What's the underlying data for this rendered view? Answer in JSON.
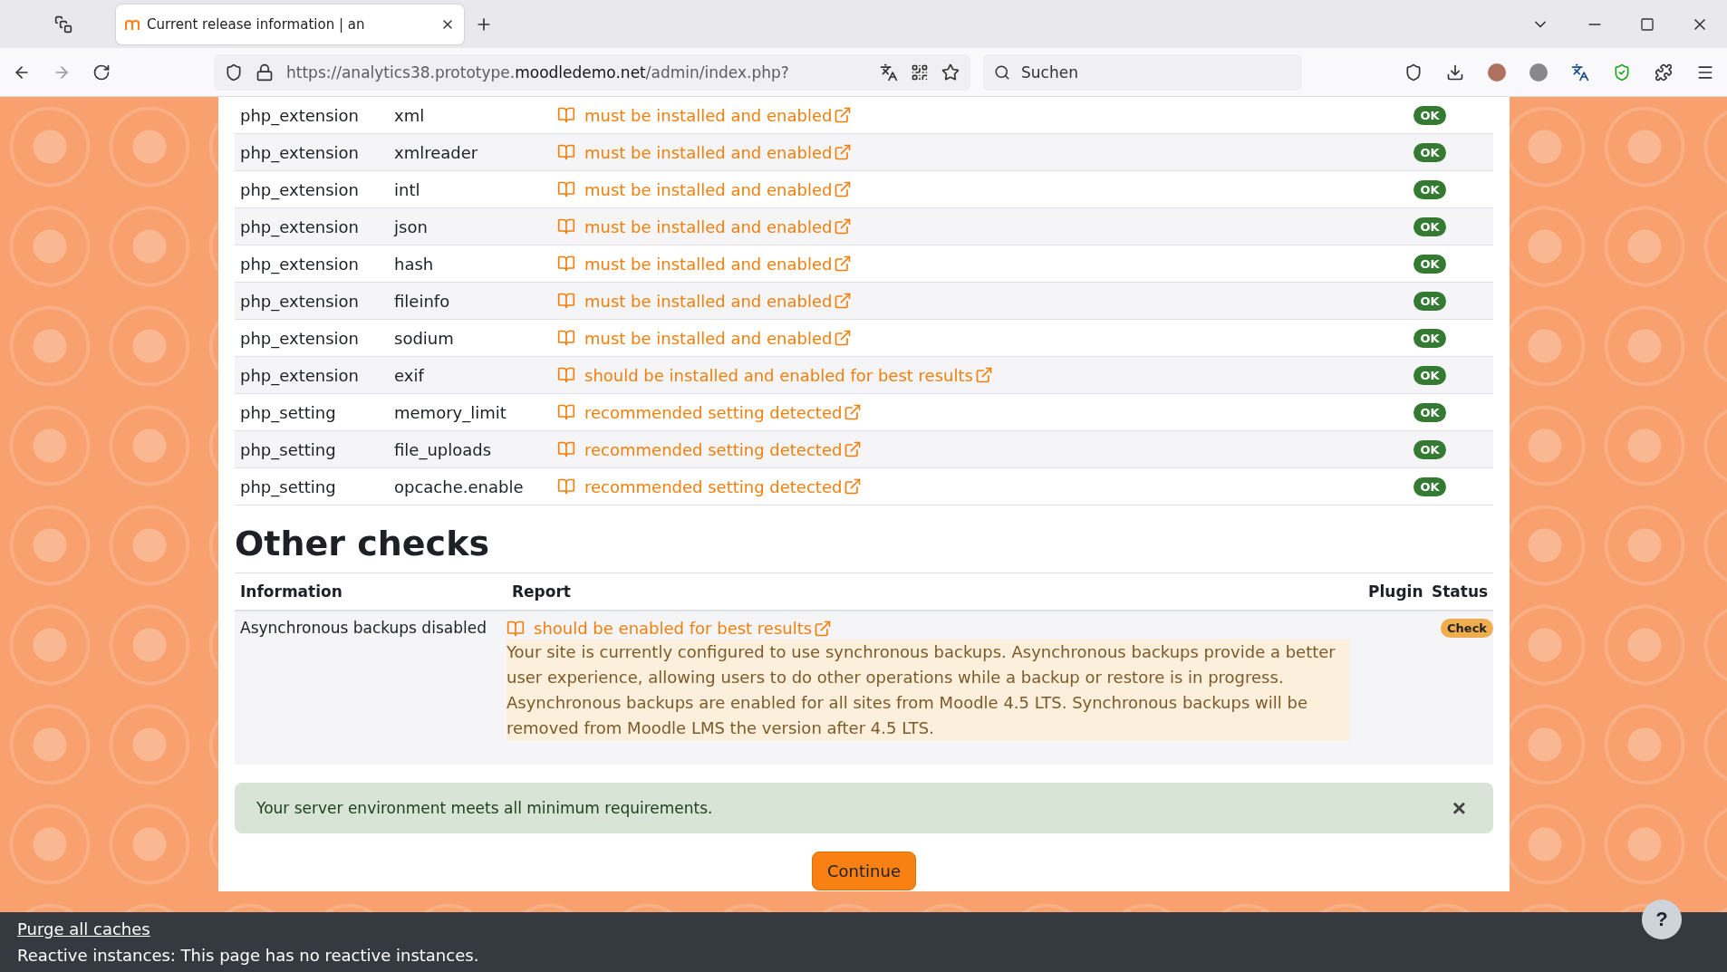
{
  "browser": {
    "tab": {
      "title": "Current release information | an",
      "selected": true
    },
    "url": {
      "prefix": "https://analytics38.prototype.",
      "domain": "moodledemo.net",
      "path": "/admin/index.php?"
    },
    "search": {
      "placeholder": "Suchen"
    }
  },
  "environment_rows": [
    {
      "type": "php_extension",
      "name": "xml",
      "report": "must be installed and enabled",
      "status": {
        "text": "OK",
        "kind": "ok"
      }
    },
    {
      "type": "php_extension",
      "name": "xmlreader",
      "report": "must be installed and enabled",
      "status": {
        "text": "OK",
        "kind": "ok"
      }
    },
    {
      "type": "php_extension",
      "name": "intl",
      "report": "must be installed and enabled",
      "status": {
        "text": "OK",
        "kind": "ok"
      }
    },
    {
      "type": "php_extension",
      "name": "json",
      "report": "must be installed and enabled",
      "status": {
        "text": "OK",
        "kind": "ok"
      }
    },
    {
      "type": "php_extension",
      "name": "hash",
      "report": "must be installed and enabled",
      "status": {
        "text": "OK",
        "kind": "ok"
      }
    },
    {
      "type": "php_extension",
      "name": "fileinfo",
      "report": "must be installed and enabled",
      "status": {
        "text": "OK",
        "kind": "ok"
      }
    },
    {
      "type": "php_extension",
      "name": "sodium",
      "report": "must be installed and enabled",
      "status": {
        "text": "OK",
        "kind": "ok"
      }
    },
    {
      "type": "php_extension",
      "name": "exif",
      "report": "should be installed and enabled for best results",
      "status": {
        "text": "OK",
        "kind": "ok"
      }
    },
    {
      "type": "php_setting",
      "name": "memory_limit",
      "report": "recommended setting detected",
      "status": {
        "text": "OK",
        "kind": "ok"
      }
    },
    {
      "type": "php_setting",
      "name": "file_uploads",
      "report": "recommended setting detected",
      "status": {
        "text": "OK",
        "kind": "ok"
      }
    },
    {
      "type": "php_setting",
      "name": "opcache.enable",
      "report": "recommended setting detected",
      "status": {
        "text": "OK",
        "kind": "ok"
      }
    }
  ],
  "other_checks": {
    "title": "Other checks",
    "columns": [
      "Information",
      "Report",
      "Plugin",
      "Status"
    ],
    "rows": [
      {
        "information": "Asynchronous backups disabled",
        "report": "should be enabled for best results",
        "details": "Your site is currently configured to use synchronous backups. Asynchronous backups provide a better user experience, allowing users to do other operations while a backup or restore is in progress. Asynchronous backups are enabled for all sites from Moodle 4.5 LTS. Synchronous backups will be removed from Moodle LMS the version after 4.5 LTS.",
        "status": {
          "text": "Check",
          "kind": "warning"
        }
      }
    ]
  },
  "alert": {
    "message": "Your server environment meets all minimum requirements.",
    "close": "×"
  },
  "continue_button": "Continue",
  "footer": {
    "link": "Purge all caches",
    "text": "Reactive instances: This page has no reactive instances.",
    "help": "?"
  }
}
